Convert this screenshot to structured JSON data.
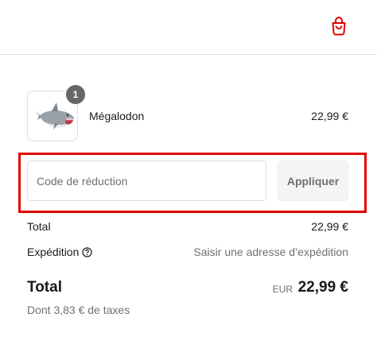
{
  "header": {
    "cart_icon": "shopping-bag-icon",
    "accent_color": "#e00000"
  },
  "product": {
    "name": "Mégalodon",
    "price": "22,99 €",
    "quantity": "1",
    "image": "shark-figurine-image"
  },
  "discount": {
    "placeholder": "Code de réduction",
    "value": "",
    "apply_label": "Appliquer"
  },
  "summary": {
    "subtotal_label": "Total",
    "subtotal_value": "22,99 €",
    "shipping_label": "Expédition",
    "shipping_value": "Saisir une adresse d’expédition",
    "help_icon": "question-circle-icon"
  },
  "total": {
    "label": "Total",
    "currency": "EUR",
    "amount": "22,99 €",
    "taxes": "Dont 3,83 € de taxes"
  }
}
